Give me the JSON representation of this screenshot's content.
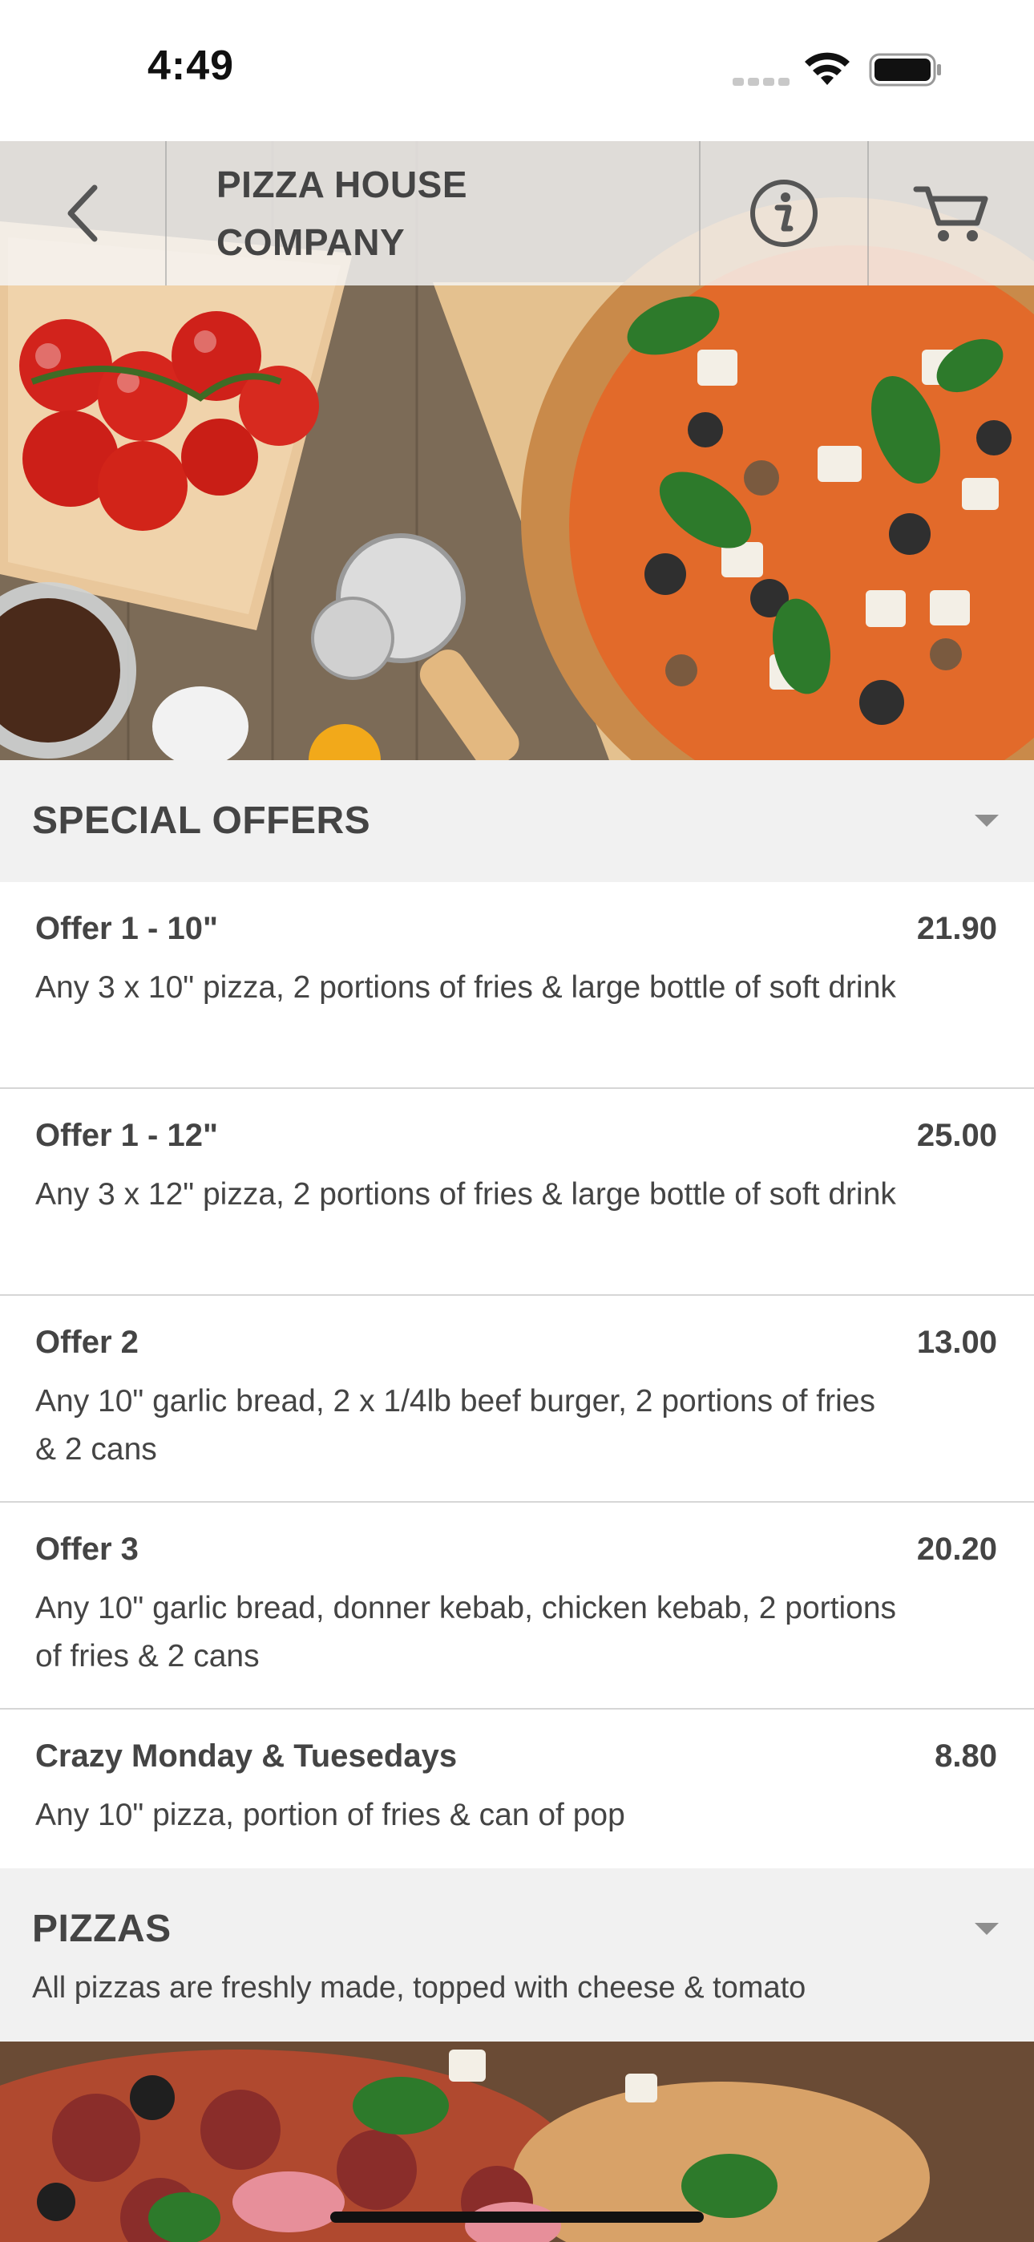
{
  "status_bar": {
    "time": "4:49"
  },
  "header": {
    "title_line1": "PIZZA HOUSE",
    "title_line2": "COMPANY",
    "back_icon": "chevron-left-icon",
    "info_icon": "info-icon",
    "cart_icon": "cart-icon"
  },
  "special_offers": {
    "title": "SPECIAL OFFERS",
    "items": [
      {
        "name": "Offer 1 - 10\"",
        "price": "21.90",
        "description": "Any 3 x 10\" pizza, 2 portions of fries & large bottle of soft drink"
      },
      {
        "name": "Offer 1 - 12\"",
        "price": "25.00",
        "description": "Any 3 x 12\" pizza, 2 portions of fries & large bottle of soft drink"
      },
      {
        "name": "Offer 2",
        "price": "13.00",
        "description": "Any 10\" garlic bread, 2 x 1/4lb beef burger, 2 portions of fries & 2 cans"
      },
      {
        "name": "Offer 3",
        "price": "20.20",
        "description": "Any 10\" garlic bread, donner kebab, chicken kebab, 2 portions of fries & 2 cans"
      },
      {
        "name": "Crazy Monday & Tuesedays",
        "price": "8.80",
        "description": "Any 10\" pizza, portion of fries & can of pop"
      }
    ]
  },
  "pizzas": {
    "title": "PIZZAS",
    "subtitle": "All pizzas are freshly made, topped with cheese & tomato"
  },
  "colors": {
    "header_bg": "#f1f1f1",
    "text": "#444444",
    "divider": "#d6d6d6"
  }
}
